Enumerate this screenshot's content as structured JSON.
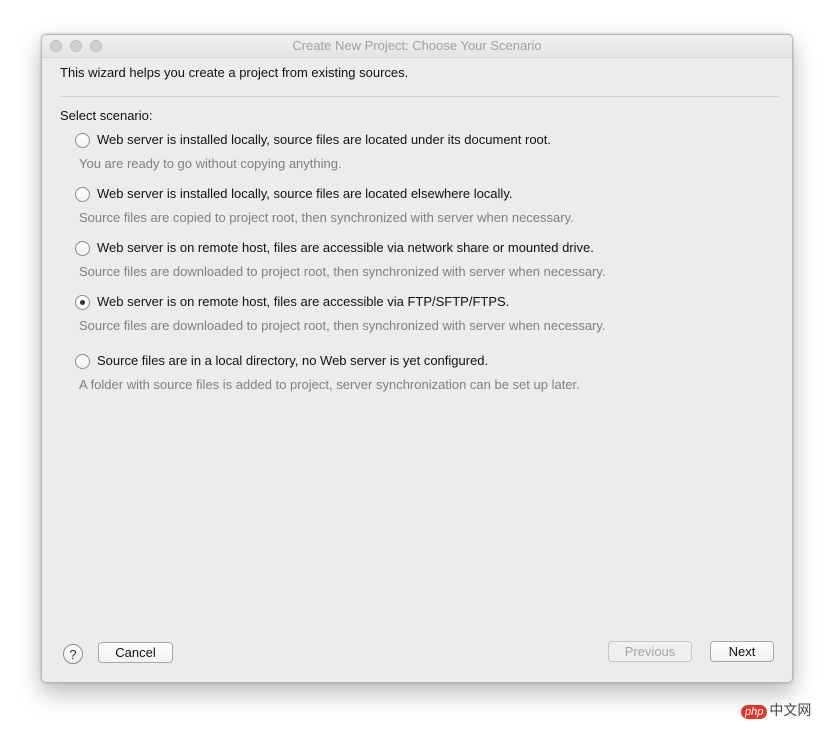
{
  "window": {
    "title": "Create New Project: Choose Your Scenario"
  },
  "intro": "This wizard helps you create a project from existing sources.",
  "select_label": "Select scenario:",
  "options": [
    {
      "label": "Web server is installed locally, source files are located under its document root.",
      "description": "You are ready to go without copying anything.",
      "selected": false
    },
    {
      "label": "Web server is installed locally, source files are located elsewhere locally.",
      "description": "Source files are copied to project root, then synchronized with server when necessary.",
      "selected": false
    },
    {
      "label": "Web server is on remote host, files are accessible via network share or mounted drive.",
      "description": "Source files are downloaded to project root, then synchronized with server when necessary.",
      "selected": false
    },
    {
      "label": "Web server is on remote host, files are accessible via FTP/SFTP/FTPS.",
      "description": "Source files are downloaded to project root, then synchronized with server when necessary.",
      "selected": true
    },
    {
      "label": "Source files are in a local directory, no Web server is yet configured.",
      "description": "A folder with source files is added to project, server synchronization can be set up later.",
      "selected": false
    }
  ],
  "footer": {
    "help_label": "?",
    "cancel_label": "Cancel",
    "previous_label": "Previous",
    "next_label": "Next"
  },
  "watermark": {
    "badge": "php",
    "text": "中文网"
  }
}
